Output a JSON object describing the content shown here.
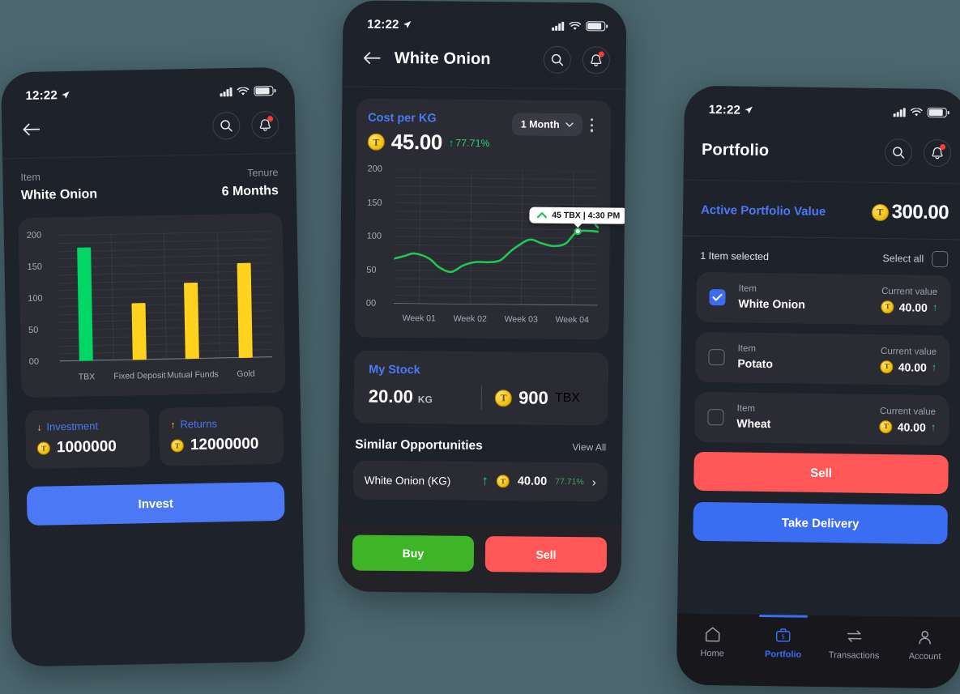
{
  "colors": {
    "page_background": "#4b666f",
    "screen_background": "#1e222b",
    "card_background": "#2b2b33",
    "accent_blue": "#4b79f6",
    "green": "#00d764",
    "yellow": "#ffd21e",
    "red": "#ff5757",
    "buy_green": "#3db527",
    "nav_background": "#17171c"
  },
  "phone1": {
    "statusbar": {
      "time": "12:22",
      "location_icon": "location-arrow-icon",
      "signal_icon": "cellular-signal-icon",
      "wifi_icon": "wifi-icon",
      "battery_icon": "battery-icon"
    },
    "header": {
      "back_icon": "arrow-left-icon",
      "search_icon": "search-icon",
      "bell_icon": "bell-icon"
    },
    "meta": {
      "item_label": "Item",
      "item_value": "White Onion",
      "tenure_label": "Tenure",
      "tenure_value": "6 Months"
    },
    "stats": {
      "investment": {
        "label": "Investment",
        "value": "1000000",
        "icon": "arrow-down-icon",
        "coin_icon": "token-coin-icon"
      },
      "returns": {
        "label": "Returns",
        "value": "12000000",
        "icon": "arrow-up-icon",
        "coin_icon": "token-coin-icon"
      }
    },
    "invest_button": "Invest"
  },
  "phone2": {
    "statusbar": {
      "time": "12:22"
    },
    "header": {
      "title": "White Onion",
      "back_icon": "arrow-left-icon",
      "search_icon": "search-icon",
      "bell_icon": "bell-icon"
    },
    "chart_card": {
      "title": "Cost per KG",
      "price": "45.00",
      "change": "77.71%",
      "change_direction": "up",
      "range_selected": "1 Month",
      "kebab_icon": "more-vertical-icon",
      "tooltip": "45 TBX | 4:30 PM"
    },
    "stock": {
      "title": "My Stock",
      "quantity": "20.00",
      "quantity_unit": "KG",
      "tokens": "900",
      "tokens_unit": "TBX"
    },
    "similar": {
      "title": "Similar Opportunities",
      "view_all": "View All",
      "rows": [
        {
          "name": "White Onion (KG)",
          "trend": "up",
          "price": "40.00",
          "change": "77.71%"
        }
      ]
    },
    "actions": {
      "buy": "Buy",
      "sell": "Sell"
    }
  },
  "phone3": {
    "statusbar": {
      "time": "12:22"
    },
    "header": {
      "title": "Portfolio",
      "search_icon": "search-icon",
      "bell_icon": "bell-icon"
    },
    "portfolio": {
      "label": "Active Portfolio Value",
      "value": "300.00"
    },
    "selection": {
      "status": "1 Item selected",
      "select_all": "Select all"
    },
    "items": [
      {
        "item_label": "Item",
        "name": "White Onion",
        "value_label": "Current value",
        "value": "40.00",
        "trend": "up",
        "checked": true
      },
      {
        "item_label": "Item",
        "name": "Potato",
        "value_label": "Current value",
        "value": "40.00",
        "trend": "up",
        "checked": false
      },
      {
        "item_label": "Item",
        "name": "Wheat",
        "value_label": "Current value",
        "value": "40.00",
        "trend": "up",
        "checked": false
      }
    ],
    "buttons": {
      "sell": "Sell",
      "take_delivery": "Take Delivery"
    },
    "nav": [
      {
        "label": "Home",
        "icon": "home-icon",
        "active": false
      },
      {
        "label": "Portfolio",
        "icon": "briefcase-dollar-icon",
        "active": true
      },
      {
        "label": "Transactions",
        "icon": "transfer-arrows-icon",
        "active": false
      },
      {
        "label": "Account",
        "icon": "person-icon",
        "active": false
      }
    ]
  },
  "chart_data": [
    {
      "type": "bar",
      "id": "phone1-investment-comparison",
      "title": "",
      "categories": [
        "TBX",
        "Fixed Deposit",
        "Mutual Funds",
        "Gold"
      ],
      "values": [
        180,
        90,
        120,
        150
      ],
      "bar_colors": [
        "#00d764",
        "#ffd21e",
        "#ffd21e",
        "#ffd21e"
      ],
      "ylim": [
        0,
        200
      ],
      "yticks": [
        "00",
        "50",
        "100",
        "150",
        "200"
      ],
      "xlabel": "",
      "ylabel": "",
      "grid": true,
      "legend": "none"
    },
    {
      "type": "line",
      "id": "phone2-cost-per-kg",
      "title": "Cost per KG",
      "categories": [
        "Week 01",
        "Week 02",
        "Week 03",
        "Week 04"
      ],
      "x": [
        0,
        5,
        10,
        17,
        22,
        28,
        34,
        40,
        46,
        52,
        58,
        66,
        72,
        78,
        84,
        90,
        100
      ],
      "values": [
        67,
        71,
        75,
        68,
        55,
        48,
        58,
        63,
        63,
        66,
        82,
        97,
        92,
        88,
        92,
        110,
        110
      ],
      "line_color": "#23c552",
      "ylim": [
        0,
        200
      ],
      "yticks": [
        "00",
        "50",
        "100",
        "150",
        "200"
      ],
      "xlabel": "",
      "ylabel": "",
      "grid": true,
      "legend": "none",
      "annotation": {
        "text": "45 TBX | 4:30 PM",
        "at_x": 90,
        "at_y": 110
      }
    }
  ]
}
